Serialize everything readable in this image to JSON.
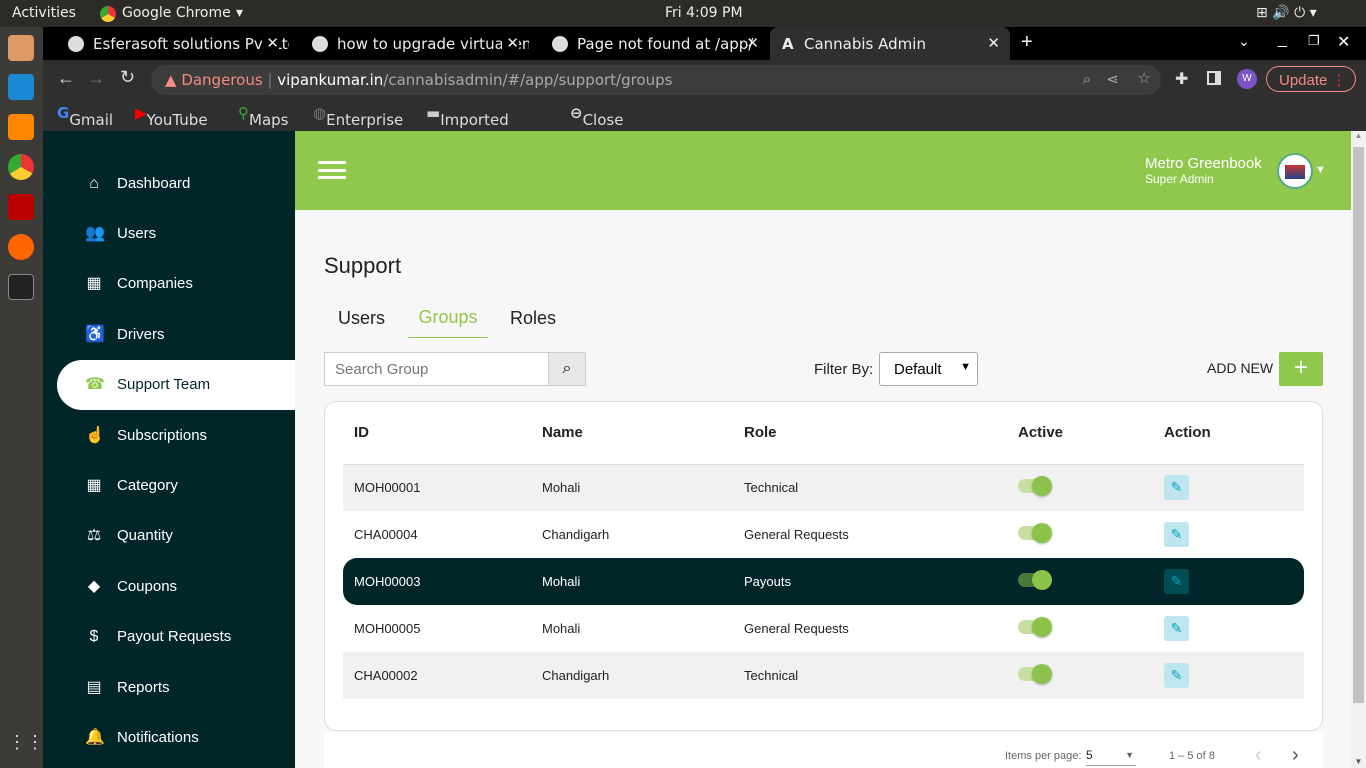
{
  "os": {
    "activities": "Activities",
    "app": "Google Chrome",
    "clock": "Fri  4:09 PM"
  },
  "browser": {
    "tabs": [
      {
        "title": "Esferasoft solutions Pvt Ltd"
      },
      {
        "title": "how to upgrade virtual env"
      },
      {
        "title": "Page not found at /app/"
      },
      {
        "title": "Cannabis Admin"
      }
    ],
    "security": "Dangerous",
    "url_domain": "vipankumar.in",
    "url_path": "/cannabisadmin/#/app/support/groups",
    "profile": "W",
    "update": "Update",
    "bookmarks": [
      "Gmail",
      "YouTube",
      "Maps",
      "Enterprise",
      "Imported Fro...",
      "Close"
    ]
  },
  "sidebar": {
    "items": [
      {
        "label": "Dashboard",
        "icon": "⌂"
      },
      {
        "label": "Users",
        "icon": "👥"
      },
      {
        "label": "Companies",
        "icon": "▦"
      },
      {
        "label": "Drivers",
        "icon": "♿"
      },
      {
        "label": "Support Team",
        "icon": "☎"
      },
      {
        "label": "Subscriptions",
        "icon": "☝"
      },
      {
        "label": "Category",
        "icon": "▦"
      },
      {
        "label": "Quantity",
        "icon": "⚖"
      },
      {
        "label": "Coupons",
        "icon": "◆"
      },
      {
        "label": "Payout Requests",
        "icon": "$"
      },
      {
        "label": "Reports",
        "icon": "▤"
      },
      {
        "label": "Notifications",
        "icon": "🔔"
      }
    ],
    "active": 4
  },
  "header": {
    "user_name": "Metro Greenbook",
    "user_role": "Super Admin"
  },
  "page": {
    "title": "Support",
    "tabs": [
      "Users",
      "Groups",
      "Roles"
    ],
    "active_tab": 1,
    "search_placeholder": "Search Group",
    "filter_label": "Filter By:",
    "filter_value": "Default",
    "add_new": "ADD NEW"
  },
  "table": {
    "columns": [
      "ID",
      "Name",
      "Role",
      "Active",
      "Action"
    ],
    "rows": [
      {
        "id": "MOH00001",
        "name": "Mohali",
        "role": "Technical",
        "active": true
      },
      {
        "id": "CHA00004",
        "name": "Chandigarh",
        "role": "General Requests",
        "active": true
      },
      {
        "id": "MOH00003",
        "name": "Mohali",
        "role": "Payouts",
        "active": true
      },
      {
        "id": "MOH00005",
        "name": "Mohali",
        "role": "General Requests",
        "active": true
      },
      {
        "id": "CHA00002",
        "name": "Chandigarh",
        "role": "Technical",
        "active": true
      }
    ],
    "highlighted_row": 2
  },
  "paginator": {
    "label": "Items per page:",
    "page_size": "5",
    "range": "1 – 5 of 8"
  },
  "colors": {
    "green": "#8fc84c",
    "sidebar": "#00262a"
  }
}
